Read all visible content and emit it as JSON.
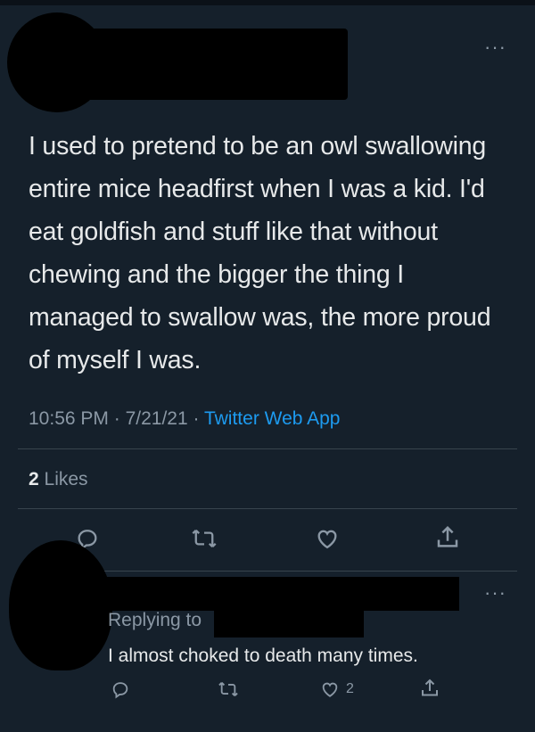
{
  "tweet": {
    "text": "I used to pretend to be an owl swallowing entire mice headfirst when I was a kid. I'd eat goldfish and stuff like that without chewing and the bigger the thing I managed to swallow was, the more proud of myself I was.",
    "time": "10:56 PM",
    "date": "7/21/21",
    "separator": "·",
    "source": "Twitter Web App",
    "likes_count": "2",
    "likes_label": "Likes",
    "more_label": "···"
  },
  "reply": {
    "replying_to_label": "Replying to",
    "text": "I almost choked to death many times.",
    "like_count": "2",
    "more_label": "···"
  },
  "colors": {
    "background": "#15202b",
    "accent": "#1d9bf0",
    "muted": "#8b98a5",
    "text": "#e7e9ea"
  },
  "icons": [
    "reply-icon",
    "retweet-icon",
    "like-icon",
    "share-icon",
    "more-icon"
  ]
}
